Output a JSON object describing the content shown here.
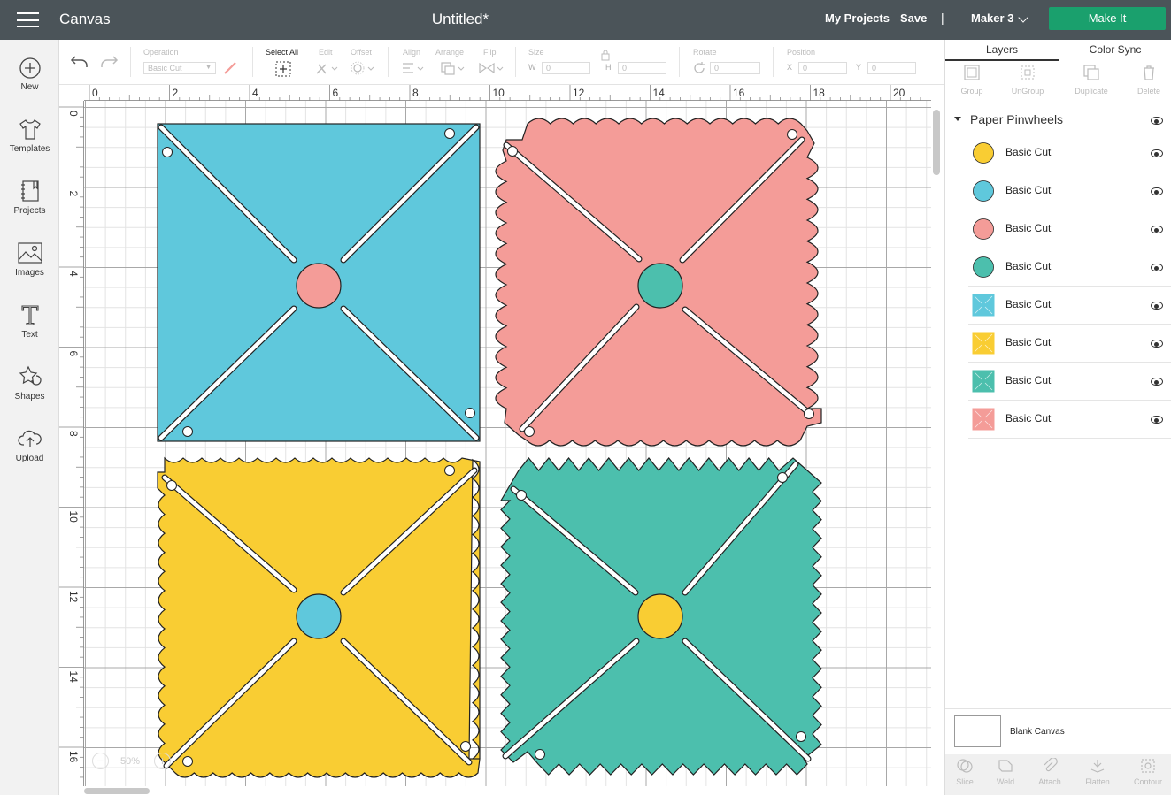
{
  "topbar": {
    "brand": "Canvas",
    "doc_title": "Untitled*",
    "my_projects": "My Projects",
    "save": "Save",
    "separator": "|",
    "machine": "Maker 3",
    "make_it": "Make It",
    "make_it_color": "#1aa06d"
  },
  "leftbar": [
    {
      "label": "New",
      "icon": "plus-circle-icon"
    },
    {
      "label": "Templates",
      "icon": "tshirt-icon"
    },
    {
      "label": "Projects",
      "icon": "notebook-icon"
    },
    {
      "label": "Images",
      "icon": "image-icon"
    },
    {
      "label": "Text",
      "icon": "text-icon"
    },
    {
      "label": "Shapes",
      "icon": "shapes-icon"
    },
    {
      "label": "Upload",
      "icon": "upload-icon"
    }
  ],
  "toolbar": {
    "operation_label": "Operation",
    "operation_value": "Basic Cut",
    "select_all": "Select All",
    "edit": "Edit",
    "offset": "Offset",
    "align": "Align",
    "arrange": "Arrange",
    "flip": "Flip",
    "size": "Size",
    "w_label": "W",
    "w_value": "0",
    "h_label": "H",
    "h_value": "0",
    "rotate": "Rotate",
    "rotate_value": "0",
    "position": "Position",
    "x_label": "X",
    "x_value": "0",
    "y_label": "Y",
    "y_value": "0"
  },
  "ruler": {
    "top_ticks": [
      "0",
      "2",
      "4",
      "6",
      "8",
      "10",
      "12",
      "14",
      "16",
      "18",
      "20"
    ],
    "left_ticks": [
      "0",
      "2",
      "4",
      "6",
      "8",
      "10",
      "12",
      "14",
      "16"
    ]
  },
  "zoom": {
    "minus": "−",
    "value": "50%",
    "plus": "+"
  },
  "panel": {
    "tabs": [
      "Layers",
      "Color Sync"
    ],
    "actions": [
      "Group",
      "UnGroup",
      "Duplicate",
      "Delete"
    ],
    "group_name": "Paper Pinwheels",
    "layers": [
      {
        "label": "Basic Cut",
        "shape": "circle",
        "color": "#f9cd33"
      },
      {
        "label": "Basic Cut",
        "shape": "circle",
        "color": "#5fc8dc"
      },
      {
        "label": "Basic Cut",
        "shape": "circle",
        "color": "#f49c98"
      },
      {
        "label": "Basic Cut",
        "shape": "circle",
        "color": "#4cbfad"
      },
      {
        "label": "Basic Cut",
        "shape": "square",
        "color": "#5fc8dc"
      },
      {
        "label": "Basic Cut",
        "shape": "square",
        "color": "#f9cd33"
      },
      {
        "label": "Basic Cut",
        "shape": "square",
        "color": "#4cbfad"
      },
      {
        "label": "Basic Cut",
        "shape": "square",
        "color": "#f49c98"
      }
    ],
    "blank_canvas": "Blank Canvas",
    "bottom_actions": [
      "Slice",
      "Weld",
      "Attach",
      "Flatten",
      "Contour"
    ]
  },
  "colors": {
    "blue": "#5fc8dc",
    "pink": "#f49c98",
    "yellow": "#f9cd33",
    "teal": "#4cbfad",
    "topbar": "#4b5459"
  }
}
